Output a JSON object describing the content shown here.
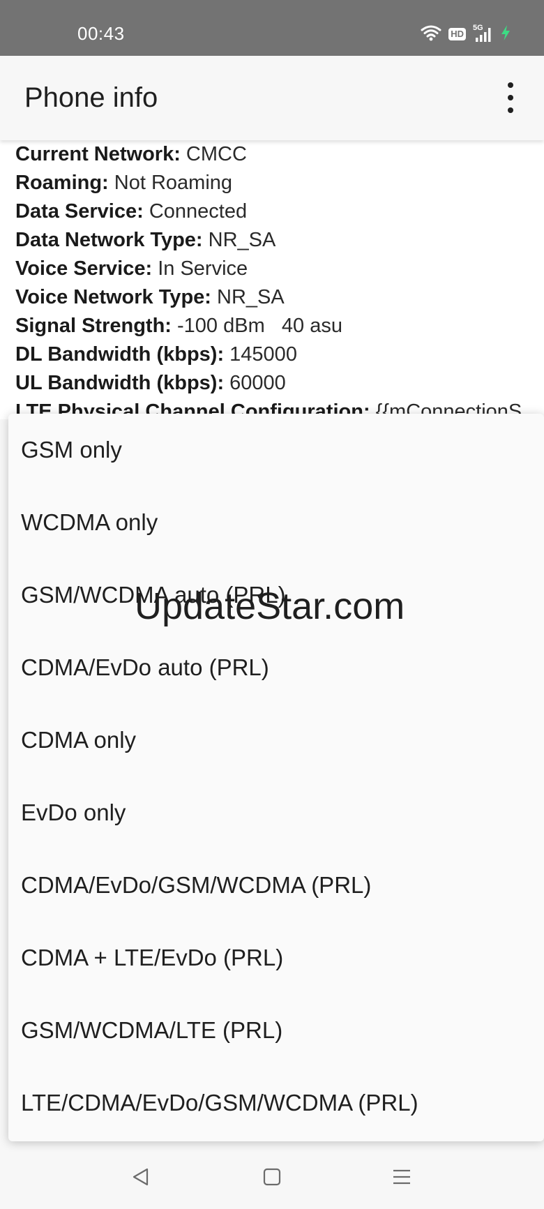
{
  "status_bar": {
    "time": "00:43",
    "hd_label": "HD",
    "network_label": "5G",
    "icons": [
      "wifi-icon",
      "hd-icon",
      "signal-5g-icon",
      "charging-icon"
    ]
  },
  "app_bar": {
    "title": "Phone info",
    "menu_icon": "more-vert-icon"
  },
  "info": [
    {
      "label": "Current Network:",
      "value": "CMCC"
    },
    {
      "label": "Roaming:",
      "value": "Not Roaming"
    },
    {
      "label": "Data Service:",
      "value": "Connected"
    },
    {
      "label": "Data Network Type:",
      "value": "NR_SA"
    },
    {
      "label": "Voice Service:",
      "value": "In Service"
    },
    {
      "label": "Voice Network Type:",
      "value": "NR_SA"
    },
    {
      "label": "Signal Strength:",
      "value": "-100 dBm   40 asu"
    },
    {
      "label": "DL Bandwidth (kbps):",
      "value": "145000"
    },
    {
      "label": "UL Bandwidth (kbps):",
      "value": "60000"
    },
    {
      "label": "LTE Physical Channel Configuration:",
      "value": "{{mConnectionS"
    }
  ],
  "network_options": [
    "GSM only",
    "WCDMA only",
    "GSM/WCDMA auto (PRL)",
    "CDMA/EvDo auto (PRL)",
    "CDMA only",
    "EvDo only",
    "CDMA/EvDo/GSM/WCDMA (PRL)",
    "CDMA + LTE/EvDo (PRL)",
    "GSM/WCDMA/LTE (PRL)",
    "LTE/CDMA/EvDo/GSM/WCDMA (PRL)"
  ],
  "watermark": "UpdateStar.com",
  "nav_bar": {
    "icons": [
      "back-icon",
      "home-icon",
      "recents-icon"
    ]
  },
  "colors": {
    "status_bar": "#737373",
    "charging": "#3ddc84",
    "background": "#f7f7f7"
  }
}
